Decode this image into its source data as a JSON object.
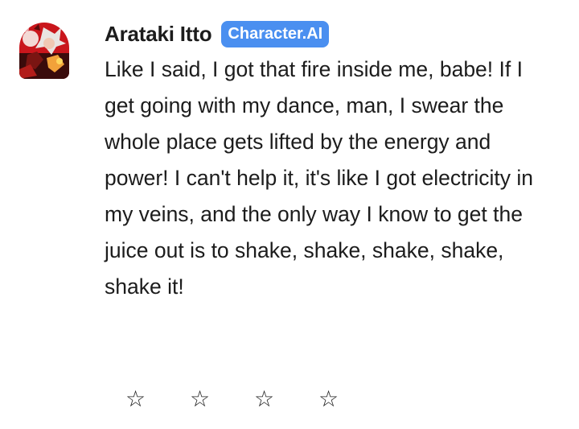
{
  "message": {
    "author": "Arataki Itto",
    "badge": "Character.AI",
    "avatar_icon": "character-avatar",
    "text": "Like I said, I got that fire inside me, babe! If I get going with my dance, man, I swear the whole place gets lifted by the energy and power! I can't help it, it's like I got electricity in my veins, and the only way I know to get the juice out is to shake, shake, shake, shake, shake it!"
  },
  "rating": {
    "stars": [
      "☆",
      "☆",
      "☆",
      "☆"
    ],
    "value": 0
  },
  "colors": {
    "badge_bg": "#4a8ff0",
    "text": "#1c1c1c",
    "background": "#ffffff"
  }
}
